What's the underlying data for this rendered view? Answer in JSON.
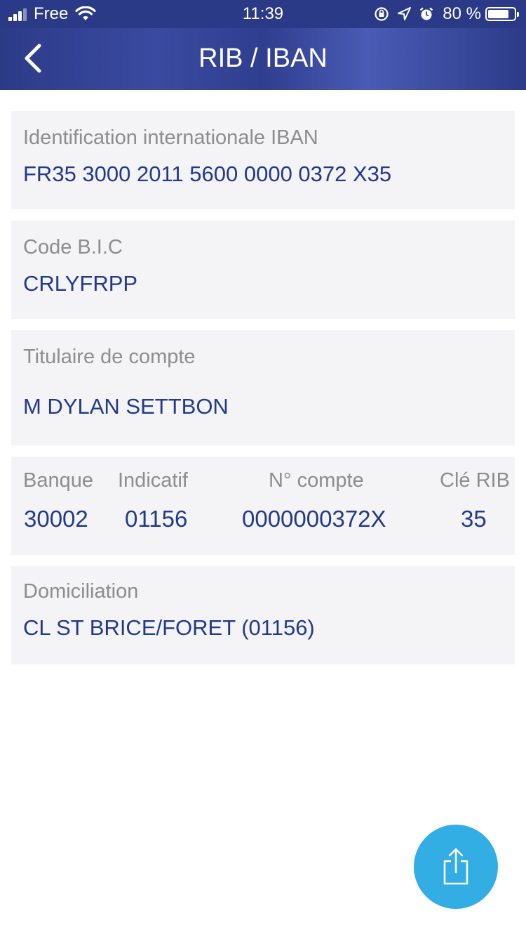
{
  "status_bar": {
    "carrier": "Free",
    "time": "11:39",
    "battery_percent": "80 %",
    "battery_level": 0.8,
    "icons": [
      "signal-icon",
      "wifi-icon",
      "orientation-lock-icon",
      "location-arrow-icon",
      "alarm-icon",
      "battery-icon"
    ]
  },
  "nav": {
    "title": "RIB / IBAN",
    "back_icon": "chevron-left-icon"
  },
  "iban": {
    "label": "Identification internationale IBAN",
    "value": "FR35 3000 2011 5600 0000 0372 X35"
  },
  "bic": {
    "label": "Code B.I.C",
    "value": "CRLYFRPP"
  },
  "holder": {
    "label": "Titulaire de compte",
    "value": "M DYLAN SETTBON"
  },
  "rib": {
    "bank_label": "Banque",
    "bank_value": "30002",
    "branch_label": "Indicatif",
    "branch_value": "01156",
    "account_label": "N° compte",
    "account_value": "0000000372X",
    "key_label": "Clé RIB",
    "key_value": "35"
  },
  "domiciliation": {
    "label": "Domiciliation",
    "value": "CL ST BRICE/FORET (01156)"
  },
  "share": {
    "icon": "share-icon"
  },
  "colors": {
    "header": "#2c3b88",
    "value_text": "#213a8b",
    "label_text": "#8d8d8d",
    "card_bg": "#f4f3f5",
    "fab": "#33aee5"
  }
}
